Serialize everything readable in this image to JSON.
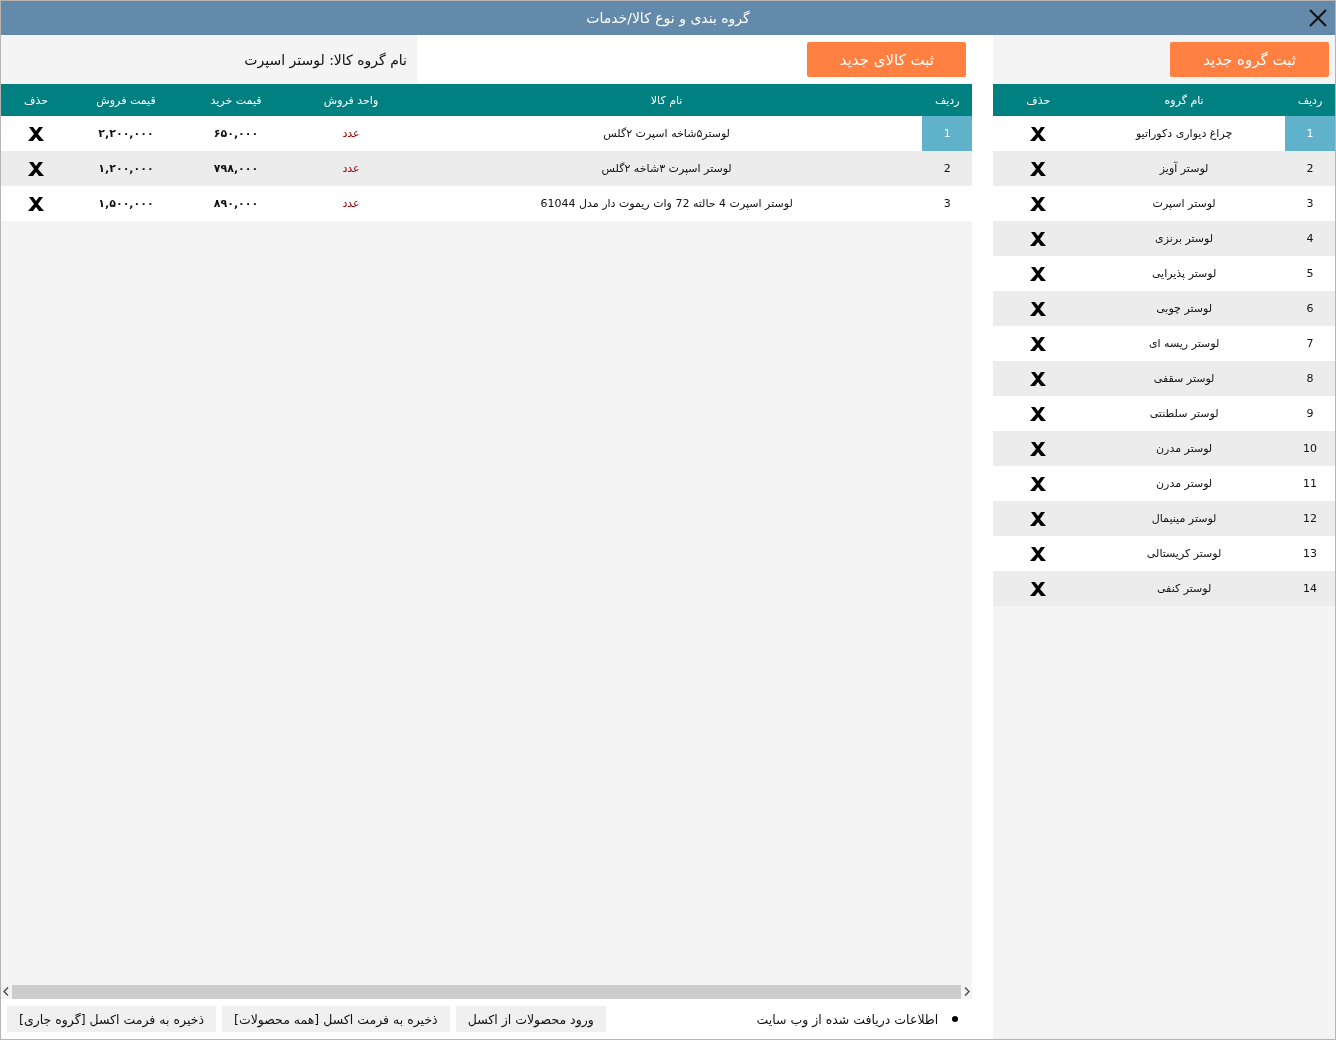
{
  "window": {
    "title": "گروه بندی و نوع کالا/خدمات"
  },
  "groups_panel": {
    "new_button": "ثبت گروه جدید",
    "columns": [
      "ردیف",
      "نام گروه",
      "حذف"
    ],
    "rows": [
      {
        "index": "1",
        "name": "چراغ دیواری دکوراتیو",
        "selected": true
      },
      {
        "index": "2",
        "name": "لوستر آویز",
        "selected": false
      },
      {
        "index": "3",
        "name": "لوستر اسپرت",
        "selected": false
      },
      {
        "index": "4",
        "name": "لوستر برنزی",
        "selected": false
      },
      {
        "index": "5",
        "name": "لوستر پذیرایی",
        "selected": false
      },
      {
        "index": "6",
        "name": "لوستر چوبی",
        "selected": false
      },
      {
        "index": "7",
        "name": "لوستر ریسه ای",
        "selected": false
      },
      {
        "index": "8",
        "name": "لوستر سقفی",
        "selected": false
      },
      {
        "index": "9",
        "name": "لوستر سلطنتی",
        "selected": false
      },
      {
        "index": "10",
        "name": "لوستر مدرن",
        "selected": false
      },
      {
        "index": "11",
        "name": "لوستر مدرن",
        "selected": false
      },
      {
        "index": "12",
        "name": "لوستر مینیمال",
        "selected": false
      },
      {
        "index": "13",
        "name": "لوستر کریستالی",
        "selected": false
      },
      {
        "index": "14",
        "name": "لوستر کنفی",
        "selected": false
      }
    ]
  },
  "products_panel": {
    "new_button": "ثبت کالای جدید",
    "group_label": "نام گروه کالا: لوستر اسپرت",
    "columns": [
      "ردیف",
      "نام کالا",
      "واحد فروش",
      "قیمت خرید",
      "قیمت فروش",
      "حذف"
    ],
    "rows": [
      {
        "index": "1",
        "name": "لوستر۵شاخه اسپرت ۲گلس",
        "unit": "عدد",
        "buy_price": "۶۵۰,۰۰۰",
        "sell_price": "۲,۲۰۰,۰۰۰",
        "selected": true
      },
      {
        "index": "2",
        "name": "لوستر اسپرت ۳شاخه ۲گلس",
        "unit": "عدد",
        "buy_price": "۷۹۸,۰۰۰",
        "sell_price": "۱,۲۰۰,۰۰۰",
        "selected": false
      },
      {
        "index": "3",
        "name": "لوستر اسپرت 4 حالته 72 وات ریموت دار مدل 61044",
        "unit": "عدد",
        "buy_price": "۸۹۰,۰۰۰",
        "sell_price": "۱,۵۰۰,۰۰۰",
        "selected": false
      }
    ]
  },
  "footer": {
    "status": "اطلاعات دریافت شده از وب سایت",
    "buttons": [
      "ورود محصولات از اکسل",
      "ذخیره به فرمت اکسل [همه محصولات]",
      "ذخیره به فرمت اکسل [گروه جاری]"
    ]
  }
}
